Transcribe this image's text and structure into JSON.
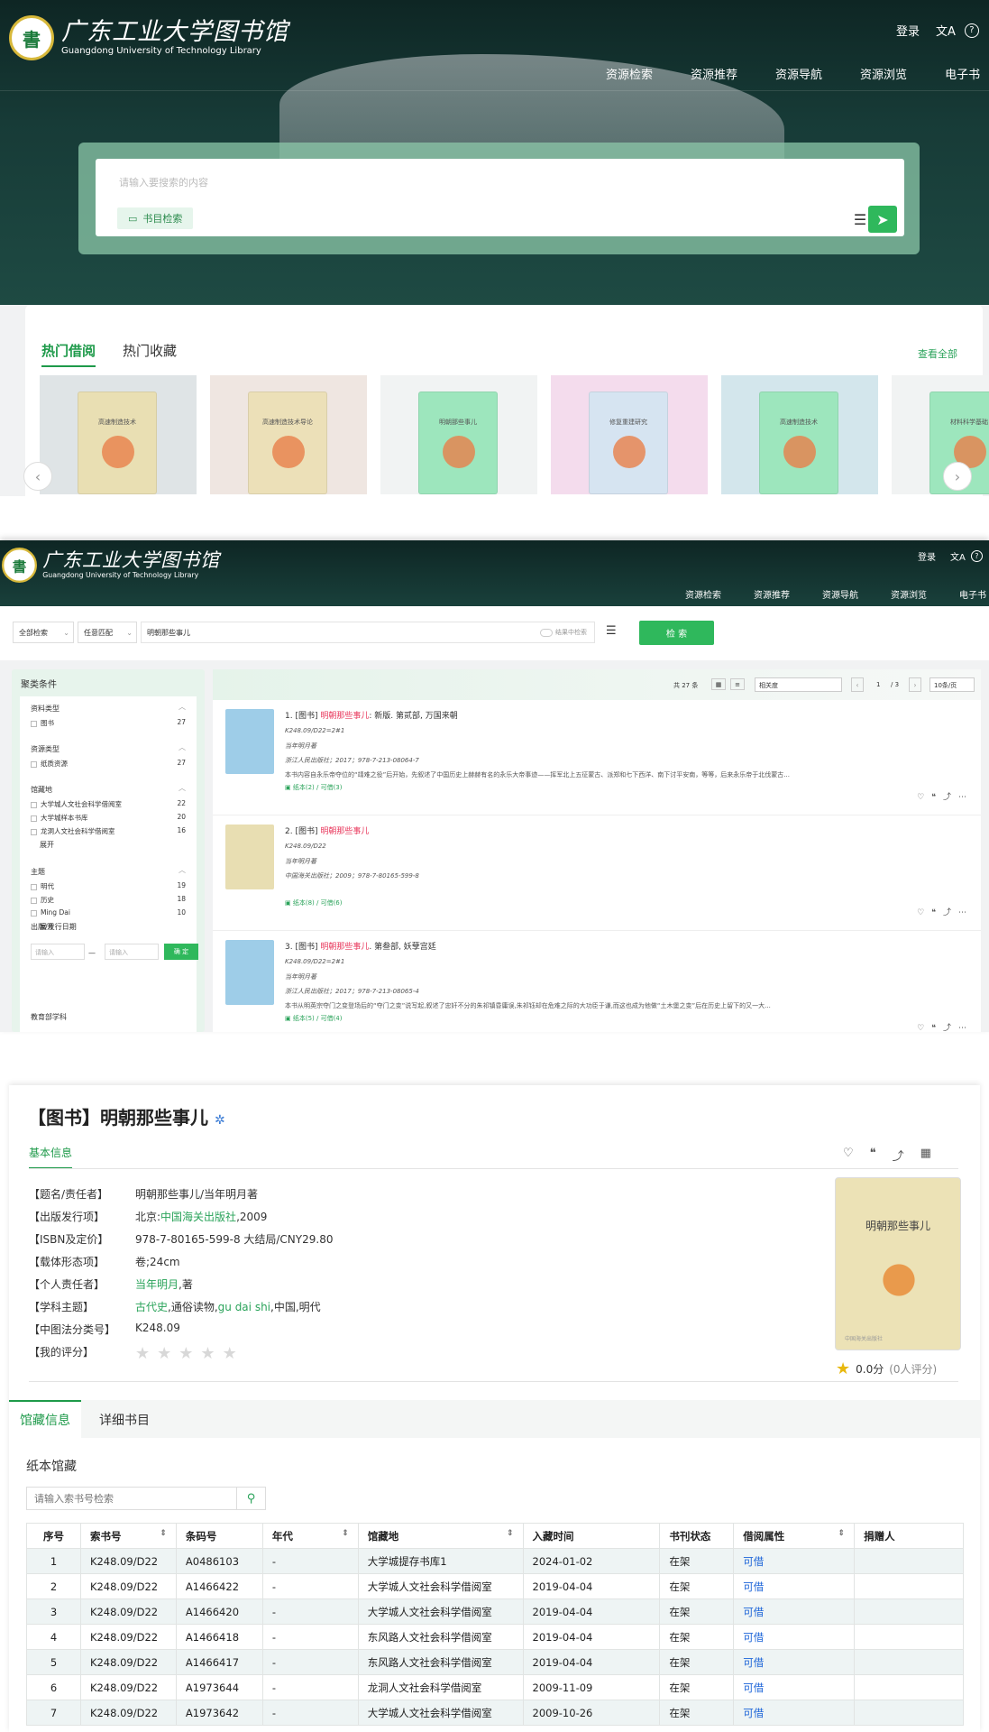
{
  "header": {
    "logo_cn": "广东工业大学图书馆",
    "logo_en": "Guangdong University of Technology Library",
    "login": "登录",
    "lang_icon": "文A",
    "help_icon": "?",
    "nav": [
      "资源检索",
      "资源推荐",
      "资源导航",
      "资源浏览",
      "电子书"
    ]
  },
  "home": {
    "search_placeholder": "请输入要搜索的内容",
    "catalog_chip": "书目检索",
    "tabs": [
      "热门借阅",
      "热门收藏"
    ],
    "view_all": "查看全部",
    "books": [
      {
        "title": "高速制造技术",
        "color": "#e9dfb3",
        "bg": "#dfe4e6"
      },
      {
        "title": "高速制造技术导论",
        "color": "#ece0b8",
        "bg": "#efe6e1"
      },
      {
        "title": "明朝那些事儿",
        "color": "#9de6bd",
        "bg": "#f1f3f3"
      },
      {
        "title": "修复重建研究",
        "color": "#d6e4f1",
        "bg": "#f4dced"
      },
      {
        "title": "高速制造技术",
        "color": "#9de6bd",
        "bg": "#d3e6ec"
      },
      {
        "title": "材料科学基础",
        "color": "#9de6bd",
        "bg": "#f1f3f3"
      }
    ]
  },
  "results": {
    "scope": "全部检索",
    "match": "任意匹配",
    "query": "明朝那些事儿",
    "within_toggle": "结果中检索",
    "search_btn": "检 索",
    "facet_title": "聚类条件",
    "total": "共 27 条",
    "sort": "相关度",
    "page": "1",
    "pages": "/ 3",
    "per_page": "10条/页",
    "facets": [
      {
        "name": "资料类型",
        "items": [
          {
            "label": "图书",
            "count": "27"
          }
        ]
      },
      {
        "name": "资源类型",
        "items": [
          {
            "label": "纸质资源",
            "count": "27"
          }
        ]
      },
      {
        "name": "馆藏地",
        "items": [
          {
            "label": "大学城人文社会科学借阅室",
            "count": "22"
          },
          {
            "label": "大学城样本书库",
            "count": "20"
          },
          {
            "label": "龙洞人文社会科学借阅室",
            "count": "16"
          }
        ]
      },
      {
        "name": "主题",
        "items": [
          {
            "label": "明代",
            "count": "19"
          },
          {
            "label": "历史",
            "count": "18"
          },
          {
            "label": "Ming Dai",
            "count": "10"
          }
        ]
      }
    ],
    "expand": "展开",
    "date_label": "出版/发行日期",
    "date_from": "请输入",
    "date_to": "请输入",
    "date_ok": "确 定",
    "edu_facet": "教育部学科",
    "items": [
      {
        "prefix": "1. [图书] ",
        "hl": "明朝那些事儿",
        "rest": ": 新版. 第贰部, 万国来朝",
        "call": "K248.09/D22=2#1",
        "author": "当年明月著",
        "pub": "浙江人民出版社；2017；978-7-213-08064-7",
        "abstract": "本书内容自永乐帝夺位的“靖难之役”后开始，先叙述了中国历史上赫赫有名的永乐大帝事迹——挥军北上五征蒙古、派郑和七下西洋、南下讨平安南，等等，后来永乐帝于北伐蒙古...",
        "holdings": "纸本(2) / 可借(3)"
      },
      {
        "prefix": "2. [图书] ",
        "hl": "明朝那些事儿",
        "rest": "",
        "call": "K248.09/D22",
        "author": "当年明月著",
        "pub": "中国海关出版社；2009；978-7-80165-599-8",
        "abstract": "",
        "holdings": "纸本(8) / 可借(6)"
      },
      {
        "prefix": "3. [图书] ",
        "hl": "明朝那些事儿",
        "rest": ". 第叁部, 妖孽宫廷",
        "call": "K248.09/D22=2#1",
        "author": "当年明月著",
        "pub": "浙江人民出版社；2017；978-7-213-08065-4",
        "abstract": "本书从明英宗夺门之变登场后的“夺门之变”说写起,叙述了忠奸不分的朱祁镇昏庸误,朱祁钰却在危难之际的大功臣于谦,而这也成为他做“土木堡之变”后在历史上留下的又一大...",
        "holdings": "纸本(5) / 可借(4)"
      }
    ]
  },
  "detail": {
    "title": "【图书】明朝那些事儿",
    "basic_tab": "基本信息",
    "fields": [
      {
        "k": "【题名/责任者】",
        "v": "明朝那些事儿/当年明月著",
        "g": ""
      },
      {
        "k": "【出版发行项】",
        "v": "北京:",
        "g": "中国海关出版社",
        "v2": ",2009"
      },
      {
        "k": "【ISBN及定价】",
        "v": "978-7-80165-599-8 大结局/CNY29.80",
        "g": ""
      },
      {
        "k": "【载体形态项】",
        "v": "卷;24cm",
        "g": ""
      },
      {
        "k": "【个人责任者】",
        "v": "",
        "g": "当年明月",
        "v2": ",著"
      },
      {
        "k": "【学科主题】",
        "v": "",
        "g": "古代史",
        "v2": ",通俗读物,",
        "g2": "gu dai shi",
        "v3": ",中国,明代"
      },
      {
        "k": "【中图法分类号】",
        "v": "K248.09",
        "g": ""
      },
      {
        "k": "【我的评分】",
        "v": "",
        "g": ""
      }
    ],
    "cover_title": "明朝那些事儿",
    "cover_pub": "中国海关出版社",
    "score": "0.0分",
    "score_count": "(0人评分)",
    "tabs": [
      "馆藏信息",
      "详细书目"
    ],
    "paper_title": "纸本馆藏",
    "call_search_placeholder": "请输入索书号检索",
    "columns": [
      "序号",
      "索书号",
      "条码号",
      "年代",
      "馆藏地",
      "入藏时间",
      "书刊状态",
      "借阅属性",
      "捐赠人"
    ],
    "rows": [
      [
        "1",
        "K248.09/D22",
        "A0486103",
        "-",
        "大学城提存书库1",
        "2024-01-02",
        "在架",
        "可借",
        ""
      ],
      [
        "2",
        "K248.09/D22",
        "A1466422",
        "-",
        "大学城人文社会科学借阅室",
        "2019-04-04",
        "在架",
        "可借",
        ""
      ],
      [
        "3",
        "K248.09/D22",
        "A1466420",
        "-",
        "大学城人文社会科学借阅室",
        "2019-04-04",
        "在架",
        "可借",
        ""
      ],
      [
        "4",
        "K248.09/D22",
        "A1466418",
        "-",
        "东风路人文社会科学借阅室",
        "2019-04-04",
        "在架",
        "可借",
        ""
      ],
      [
        "5",
        "K248.09/D22",
        "A1466417",
        "-",
        "东风路人文社会科学借阅室",
        "2019-04-04",
        "在架",
        "可借",
        ""
      ],
      [
        "6",
        "K248.09/D22",
        "A1973644",
        "-",
        "龙洞人文社会科学借阅室",
        "2009-11-09",
        "在架",
        "可借",
        ""
      ],
      [
        "7",
        "K248.09/D22",
        "A1973642",
        "-",
        "大学城人文社会科学借阅室",
        "2009-10-26",
        "在架",
        "可借",
        ""
      ]
    ]
  },
  "colors": {
    "brand_green": "#1e9a4a",
    "accent_green": "#2fb85c",
    "highlight_pink": "#e8355a",
    "link_blue": "#1c64d8"
  }
}
